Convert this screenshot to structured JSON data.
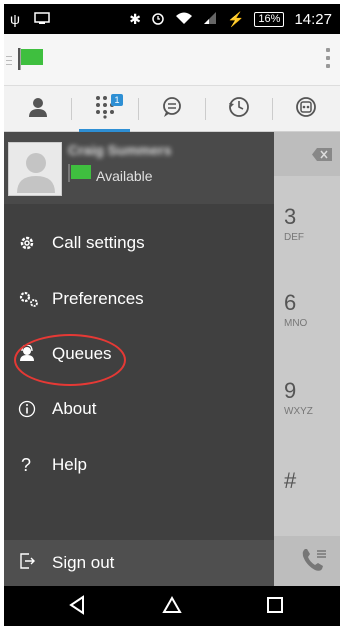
{
  "statusbar": {
    "battery": "16%",
    "time": "14:27",
    "icons": [
      "usb-icon",
      "cast-icon",
      "bluetooth-icon",
      "alarm-icon",
      "wifi-icon",
      "signal-icon",
      "charging-icon"
    ]
  },
  "appbar": {
    "logo": "green-flag-icon",
    "menu": "overflow-menu-icon"
  },
  "tabs": [
    {
      "name": "contacts",
      "icon": "person-icon"
    },
    {
      "name": "dialpad",
      "icon": "dialpad-icon",
      "badge": "1",
      "active": true
    },
    {
      "name": "chat",
      "icon": "chat-icon"
    },
    {
      "name": "history",
      "icon": "history-icon"
    },
    {
      "name": "voicemail",
      "icon": "voicemail-icon"
    }
  ],
  "drawer": {
    "profile": {
      "name": "Craig Summers",
      "status": "Available",
      "status_color": "#3fbf3f"
    },
    "items": [
      {
        "label": "Call settings",
        "icon": "gear-icon"
      },
      {
        "label": "Preferences",
        "icon": "gears-icon"
      },
      {
        "label": "Queues",
        "icon": "queue-agent-icon"
      },
      {
        "label": "About",
        "icon": "info-icon"
      },
      {
        "label": "Help",
        "icon": "question-icon"
      }
    ],
    "signout_label": "Sign out"
  },
  "dialpad": {
    "keys": [
      {
        "num": "3",
        "letters": "DEF"
      },
      {
        "num": "6",
        "letters": "MNO"
      },
      {
        "num": "9",
        "letters": "WXYZ"
      },
      {
        "num": "#",
        "letters": ""
      }
    ]
  },
  "navbar": {
    "icons": [
      "back-icon",
      "home-icon",
      "recents-icon"
    ]
  },
  "colors": {
    "accent": "#2e8fd4",
    "drawer_bg": "#404040",
    "highlight_circle": "#e53935",
    "flag_green": "#3fbf3f"
  }
}
